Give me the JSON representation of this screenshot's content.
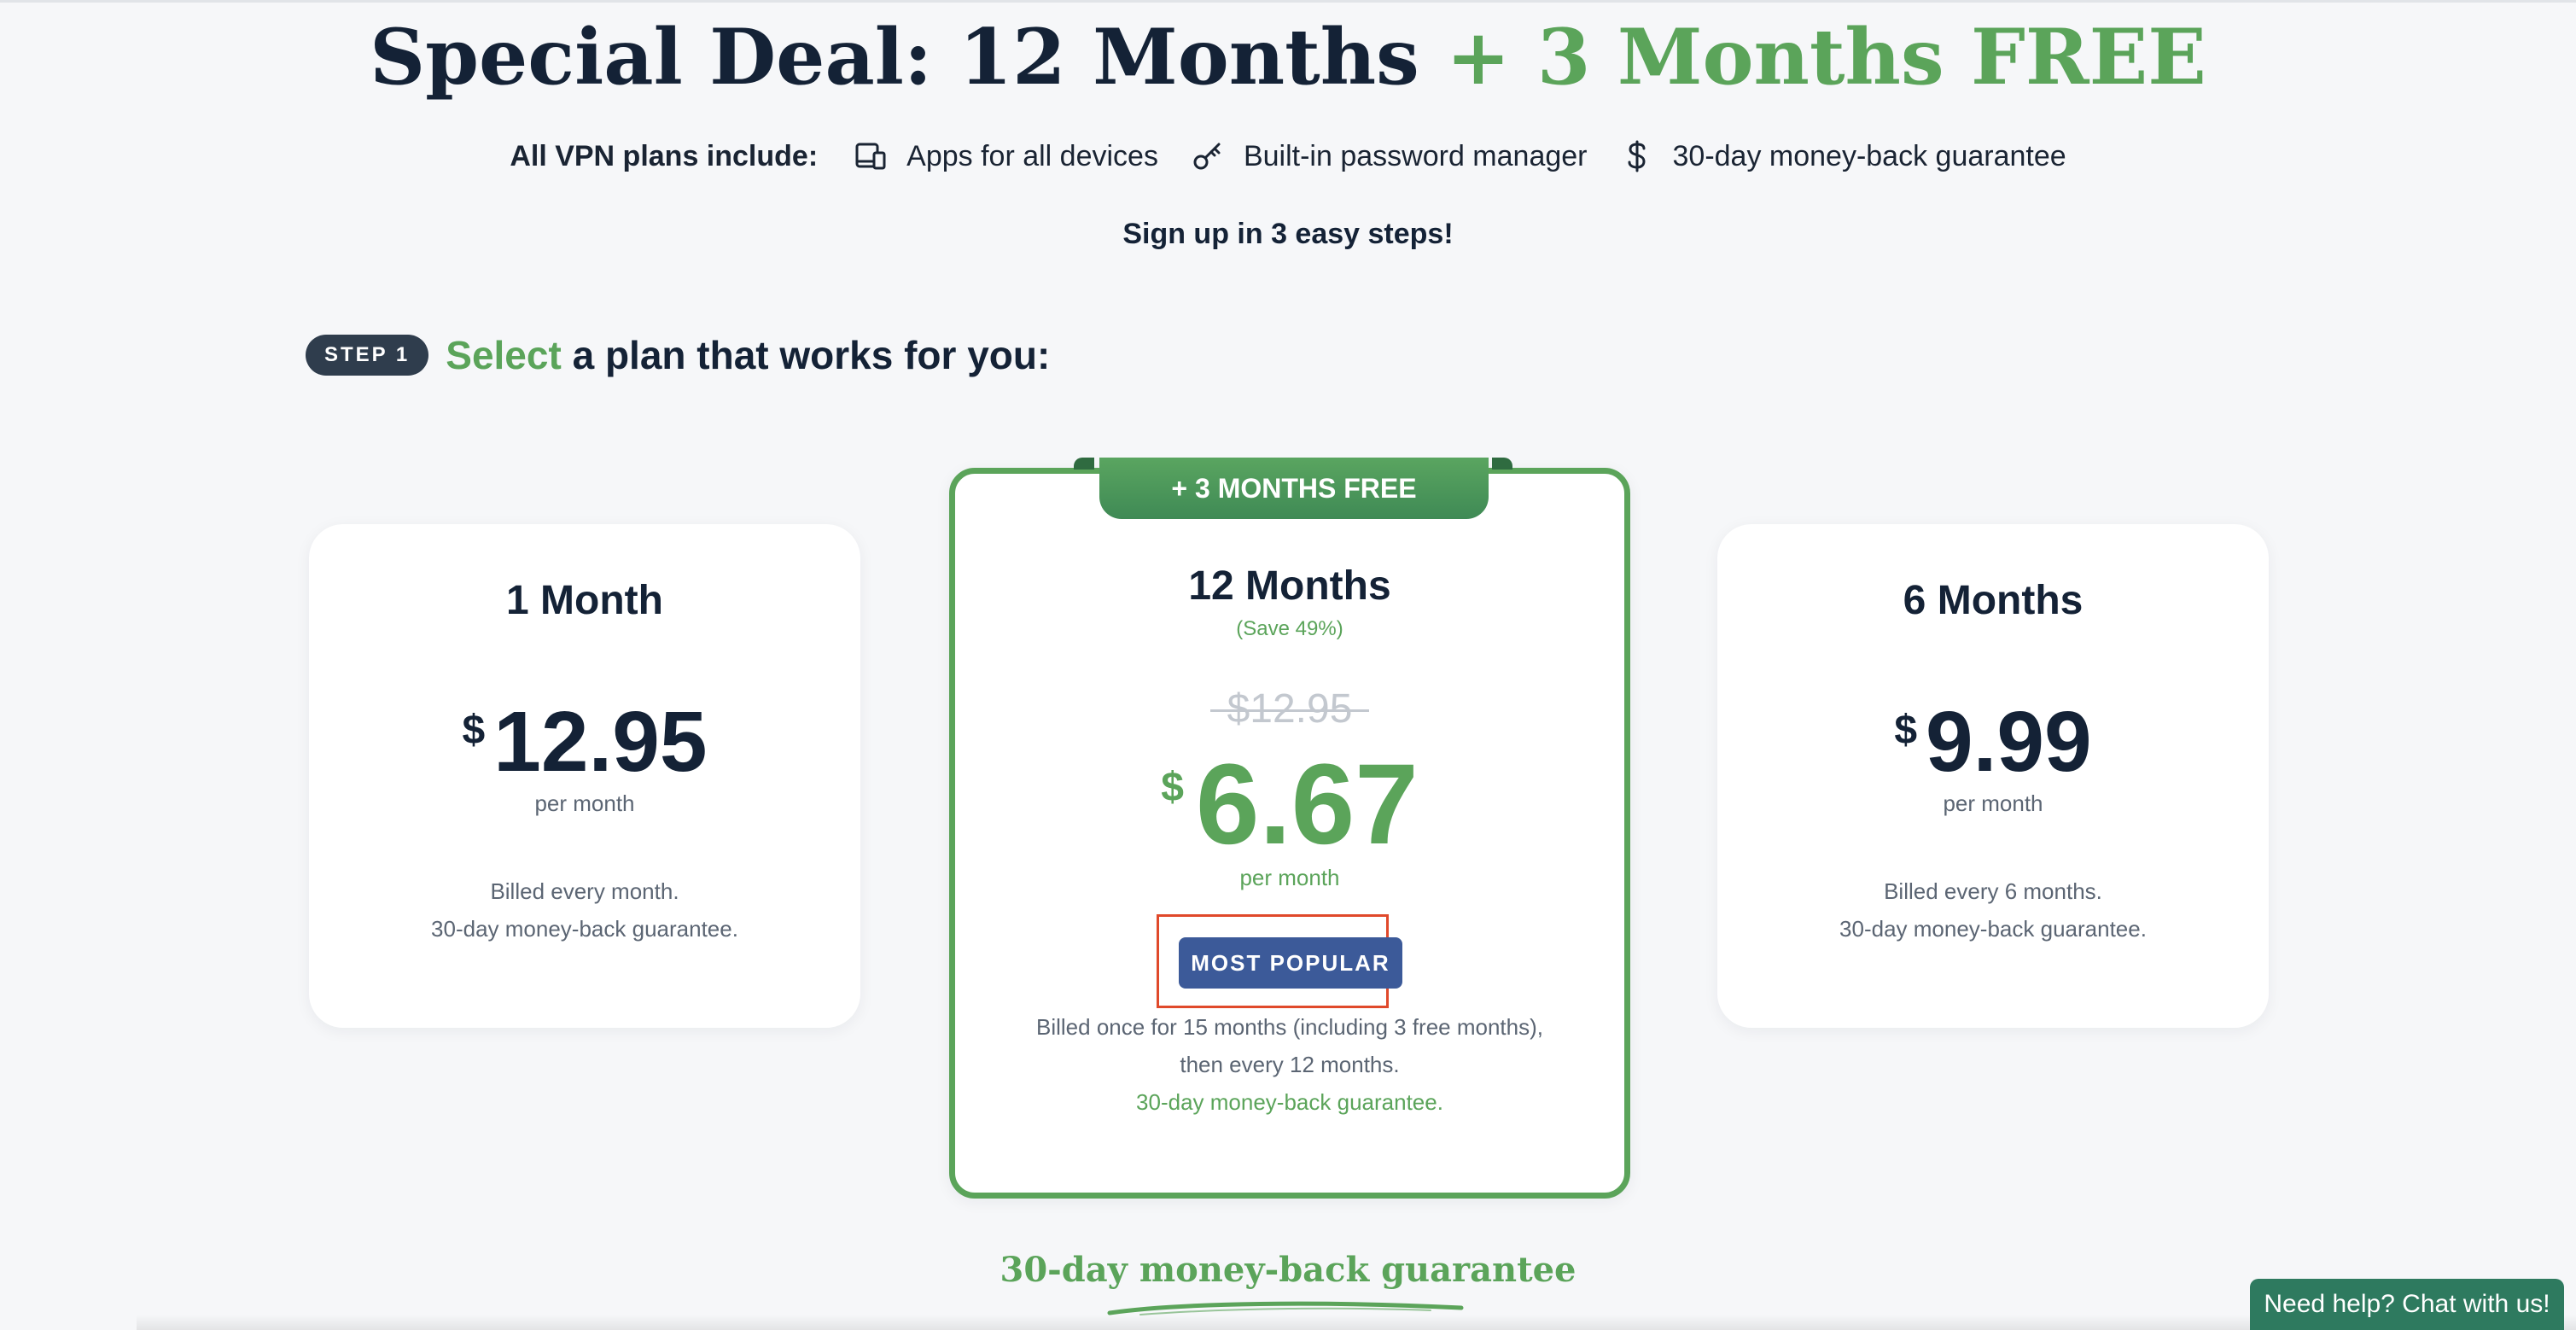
{
  "headline": {
    "main": "Special Deal: 12 Months ",
    "accent": "+ 3 Months FREE"
  },
  "includes": {
    "lead": "All VPN plans include:",
    "items": [
      {
        "icon": "devices-icon",
        "label": "Apps for all devices"
      },
      {
        "icon": "key-icon",
        "label": "Built-in password manager"
      },
      {
        "icon": "dollar-icon",
        "label": "30-day money-back guarantee"
      }
    ]
  },
  "steps_note": "Sign up in 3 easy steps!",
  "step1": {
    "badge": "STEP 1",
    "accent": "Select",
    "rest": " a plan that works for you:"
  },
  "plans": {
    "one_month": {
      "name": "1 Month",
      "currency": "$",
      "price": "12.95",
      "per": "per month",
      "billing_line1": "Billed every month.",
      "billing_line2": "30-day money-back guarantee."
    },
    "twelve_month": {
      "ribbon": "+ 3 MONTHS FREE",
      "name": "12 Months",
      "save": "(Save 49%)",
      "old_price": "$12.95",
      "currency": "$",
      "price": "6.67",
      "per": "per month",
      "badge": "MOST POPULAR",
      "billing_line1": "Billed once for 15 months (including 3 free months),",
      "billing_line2": "then every 12 months.",
      "billing_line3": "30-day money-back guarantee."
    },
    "six_month": {
      "name": "6 Months",
      "currency": "$",
      "price": "9.99",
      "per": "per month",
      "billing_line1": "Billed every 6 months.",
      "billing_line2": "30-day money-back guarantee."
    }
  },
  "guarantee_banner": "30-day money-back guarantee",
  "chat": "Need help? Chat with us!",
  "colors": {
    "brand_green": "#5ba45a",
    "navy": "#142236",
    "button_blue": "#3c5a99",
    "highlight_red": "#e0492b",
    "chat_green": "#2e7a5f"
  }
}
